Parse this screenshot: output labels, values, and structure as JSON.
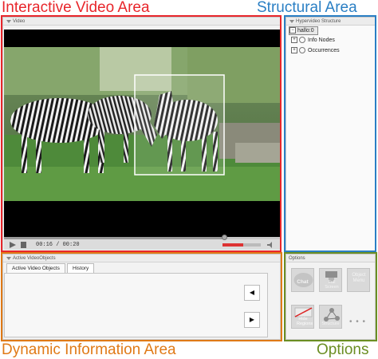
{
  "annotations": {
    "interactive_video_area": "Interactive Video Area",
    "structural_area": "Structural Area",
    "dynamic_information_area": "Dynamic Information Area",
    "options": "Options"
  },
  "colors": {
    "interactive_video_area": "#e8262b",
    "structural_area": "#2a7fc4",
    "dynamic_information_area": "#e07a17",
    "options": "#6b8e23"
  },
  "video_panel": {
    "title": "Video",
    "timecode": "00:16 / 00:20",
    "progress": 0.8,
    "volume": 0.55
  },
  "structure_panel": {
    "title": "Hypervideo Structure",
    "root": "hallo:0",
    "nodes": [
      "Info Nodes",
      "Occurrences"
    ]
  },
  "active_objects_panel": {
    "title": "Active VideoObjects",
    "tabs": [
      "Active Video Objects",
      "History"
    ],
    "prev_glyph": "◀",
    "next_glyph": "▶"
  },
  "options_panel": {
    "title": "Options",
    "buttons": [
      "Chat",
      "Full Screen",
      "Object Menu",
      "Hide Regions",
      "Structure"
    ],
    "more": "• • •"
  }
}
